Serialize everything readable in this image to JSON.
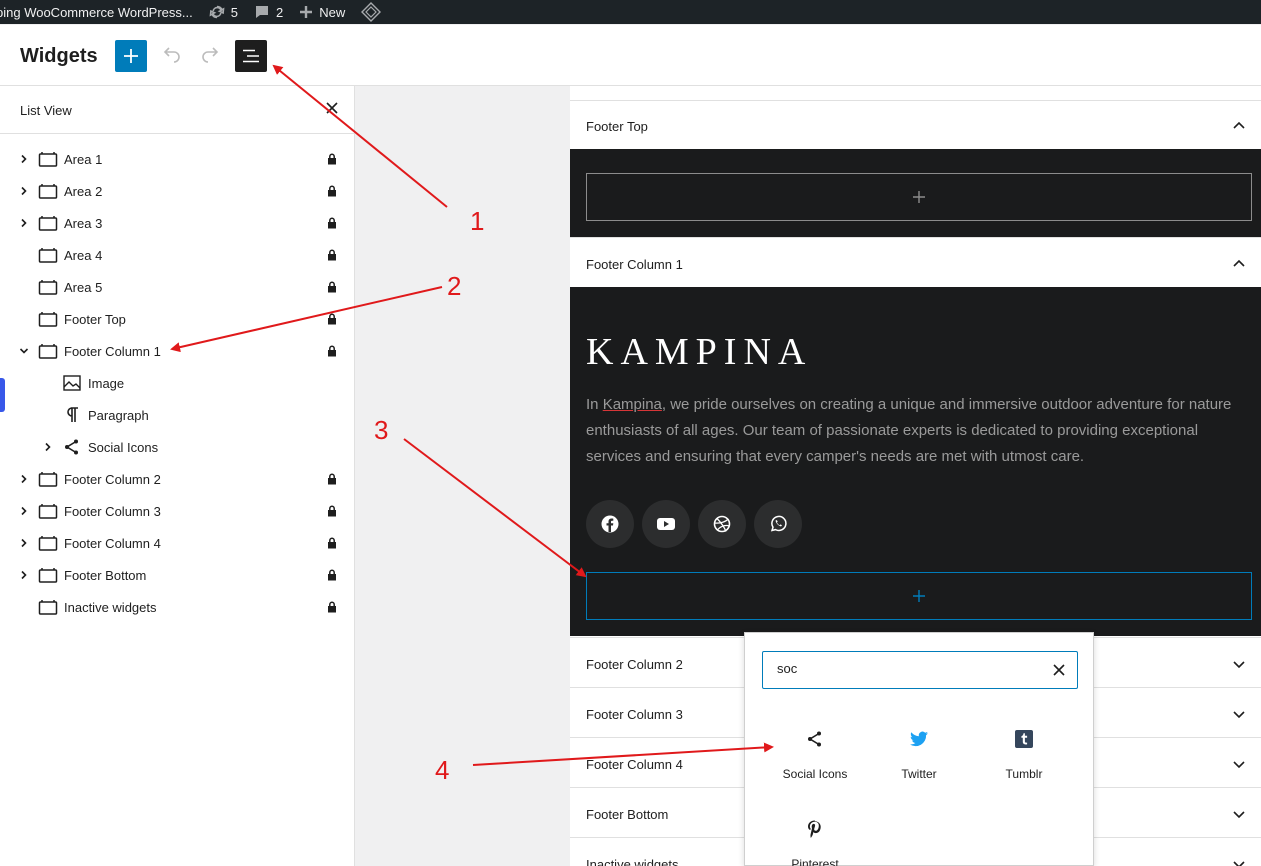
{
  "admin_bar": {
    "site_name": "ping WooCommerce WordPress...",
    "updates_count": "5",
    "comments_count": "2",
    "new_label": "New"
  },
  "header": {
    "title": "Widgets",
    "icons": [
      "plus-icon",
      "undo-icon",
      "redo-icon",
      "list-view-icon"
    ]
  },
  "list_view": {
    "title": "List View",
    "items": [
      {
        "label": "Area 1",
        "expandable": true,
        "locked": true
      },
      {
        "label": "Area 2",
        "expandable": true,
        "locked": true
      },
      {
        "label": "Area 3",
        "expandable": true,
        "locked": true
      },
      {
        "label": "Area 4",
        "expandable": false,
        "locked": true
      },
      {
        "label": "Area 5",
        "expandable": false,
        "locked": true
      },
      {
        "label": "Footer Top",
        "expandable": false,
        "locked": true
      },
      {
        "label": "Footer Column 1",
        "expanded": true,
        "locked": true
      },
      {
        "label": "Image",
        "child": true
      },
      {
        "label": "Paragraph",
        "child": true
      },
      {
        "label": "Social Icons",
        "child": true,
        "expandable": true
      },
      {
        "label": "Footer Column 2",
        "expandable": true,
        "locked": true
      },
      {
        "label": "Footer Column 3",
        "expandable": true,
        "locked": true
      },
      {
        "label": "Footer Column 4",
        "expandable": true,
        "locked": true
      },
      {
        "label": "Footer Bottom",
        "expandable": true,
        "locked": true
      },
      {
        "label": "Inactive widgets",
        "expandable": false,
        "locked": true
      }
    ]
  },
  "editor": {
    "footer_top": "Footer Top",
    "footer_column_1": "Footer Column 1",
    "brand": "KAMPINA",
    "paragraph_before": "In ",
    "paragraph_link": "Kampina",
    "paragraph_after": ", we pride ourselves on creating a unique and immersive outdoor adventure for nature enthusiasts of all ages. Our team of passionate experts is dedicated to providing exceptional services and ensuring that every camper's needs are met with utmost care.",
    "social_icons": [
      "facebook-icon",
      "youtube-icon",
      "dribbble-icon",
      "whatsapp-icon"
    ],
    "collapsed_panels": [
      "Footer Column 2",
      "Footer Column 3",
      "Footer Column 4",
      "Footer Bottom",
      "Inactive widgets"
    ]
  },
  "inserter": {
    "search_value": "soc",
    "blocks": [
      {
        "label": "Social Icons",
        "icon": "share-icon"
      },
      {
        "label": "Twitter",
        "icon": "twitter-icon"
      },
      {
        "label": "Tumblr",
        "icon": "tumblr-icon"
      },
      {
        "label": "Pinterest",
        "icon": "pinterest-icon"
      }
    ]
  },
  "annotations": [
    "1",
    "2",
    "3",
    "4"
  ],
  "colors": {
    "admin_bar": "#1d2327",
    "accent": "#007cba",
    "dark_panel": "#1a1b1c",
    "annotation": "#e0191b"
  }
}
